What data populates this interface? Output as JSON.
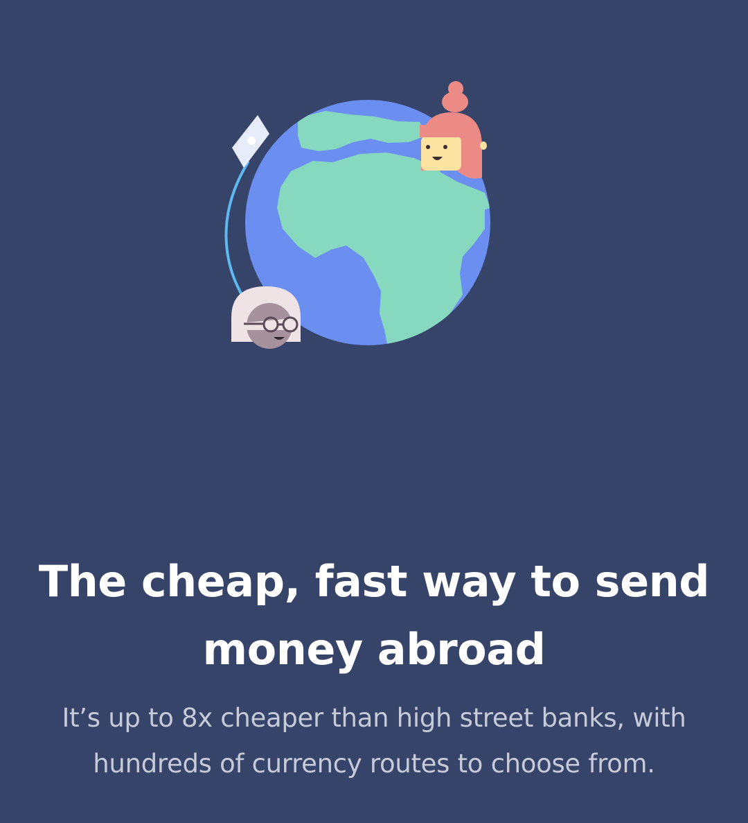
{
  "onboarding": {
    "headline": "The cheap, fast way to send money abroad",
    "subtext": "It’s up to 8x cheaper than high street banks, with hundreds of currency routes to choose from."
  },
  "illustration": {
    "icons": [
      "globe-icon",
      "paper-plane-icon",
      "woman-avatar-icon",
      "man-avatar-icon"
    ]
  },
  "colors": {
    "background": "#374469",
    "ocean": "#6b8ff1",
    "land": "#86d9bf",
    "orbit": "#5fb8f0",
    "woman_hair": "#ec8a85",
    "woman_skin": "#fde3a1",
    "man_hair": "#efe3e6",
    "man_skin": "#a5929d",
    "headline": "#ffffff",
    "subtext": "#c6cbda"
  }
}
